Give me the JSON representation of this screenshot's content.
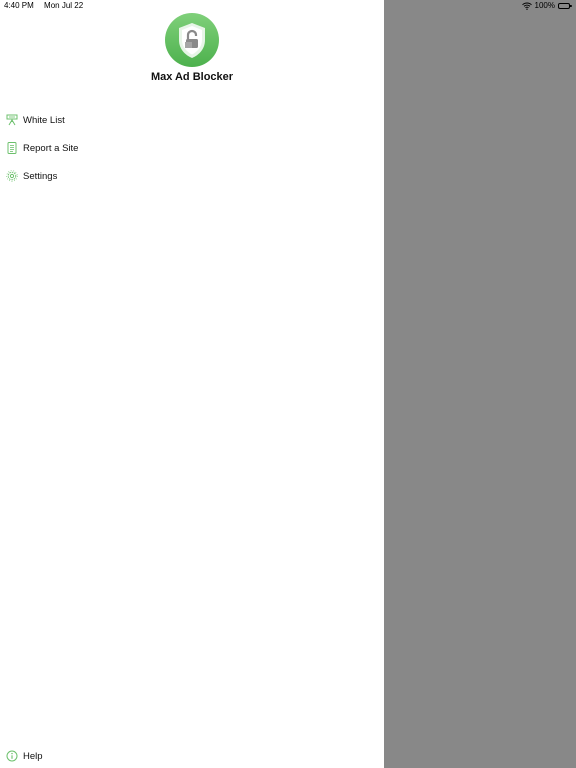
{
  "status_bar": {
    "time": "4:40 PM",
    "date": "Mon Jul 22",
    "battery": "100%"
  },
  "app": {
    "name": "Max Ad Blocker",
    "logo_icon": "shield-lock-icon",
    "accent_color": "#5cbd5c"
  },
  "menu": {
    "items": [
      {
        "label": "White List",
        "icon": "whitelist-icon"
      },
      {
        "label": "Report a Site",
        "icon": "document-icon"
      },
      {
        "label": "Settings",
        "icon": "gear-icon"
      }
    ],
    "help": {
      "label": "Help",
      "icon": "info-icon"
    }
  },
  "overlay_color": "#888888"
}
